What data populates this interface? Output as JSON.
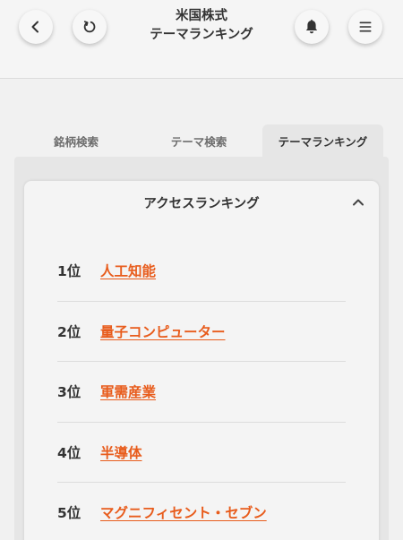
{
  "header": {
    "title_line1": "米国株式",
    "title_line2": "テーマランキング",
    "icons": {
      "back": "chevron-left-icon",
      "refresh": "refresh-icon",
      "notifications": "bell-icon",
      "menu": "hamburger-menu-icon"
    }
  },
  "tabs": [
    {
      "label": "銘柄検索",
      "active": false
    },
    {
      "label": "テーマ検索",
      "active": false
    },
    {
      "label": "テーマランキング",
      "active": true
    }
  ],
  "ranking": {
    "title": "アクセスランキング",
    "collapse_icon": "chevron-up-icon",
    "items": [
      {
        "rank": "1位",
        "theme": "人工知能"
      },
      {
        "rank": "2位",
        "theme": "量子コンピューター"
      },
      {
        "rank": "3位",
        "theme": "軍需産業"
      },
      {
        "rank": "4位",
        "theme": "半導体"
      },
      {
        "rank": "5位",
        "theme": "マグニフィセント・セブン"
      }
    ]
  },
  "colors": {
    "link": "#e85c1c",
    "background": "#f1f1f1",
    "active_tab": "#e6e6e6",
    "text": "#333333"
  }
}
